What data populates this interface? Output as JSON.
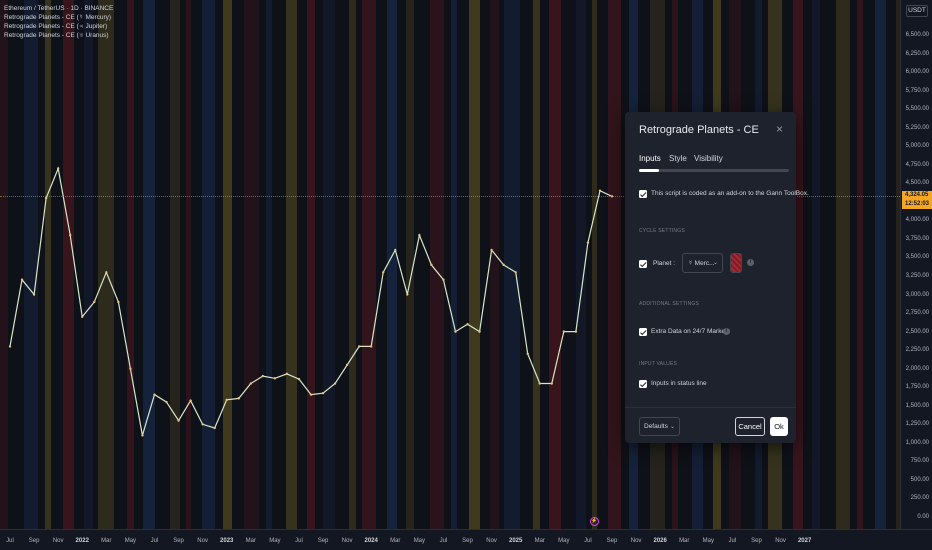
{
  "legend": {
    "symbol_line": "Ethereum / TetherUS · 1D · BINANCE",
    "indicators": [
      "Retrograde Planets - CE (☿ Mercury)",
      "Retrograde Planets - CE (♃ Jupiter)",
      "Retrograde Planets - CE (♅ Uranus)"
    ]
  },
  "quote_currency": "USDT",
  "y_axis_ticks": [
    "6,500.00",
    "6,250.00",
    "6,000.00",
    "5,750.00",
    "5,500.00",
    "5,250.00",
    "5,000.00",
    "4,750.00",
    "4,500.00",
    "4,250.00",
    "4,000.00",
    "3,750.00",
    "3,500.00",
    "3,250.00",
    "3,000.00",
    "2,750.00",
    "2,500.00",
    "2,250.00",
    "2,000.00",
    "1,750.00",
    "1,500.00",
    "1,250.00",
    "1,000.00",
    "750.00",
    "500.00",
    "250.00",
    "0.00"
  ],
  "price_tags": {
    "last_price": "4,324.05",
    "countdown": "12:52:03",
    "last_color": "#f5a623",
    "countdown_color": "#f5a623"
  },
  "x_axis_ticks": [
    {
      "label": "Jul",
      "year": false
    },
    {
      "label": "Sep",
      "year": false
    },
    {
      "label": "Nov",
      "year": false
    },
    {
      "label": "2022",
      "year": true
    },
    {
      "label": "Mar",
      "year": false
    },
    {
      "label": "May",
      "year": false
    },
    {
      "label": "Jul",
      "year": false
    },
    {
      "label": "Sep",
      "year": false
    },
    {
      "label": "Nov",
      "year": false
    },
    {
      "label": "2023",
      "year": true
    },
    {
      "label": "Mar",
      "year": false
    },
    {
      "label": "May",
      "year": false
    },
    {
      "label": "Jul",
      "year": false
    },
    {
      "label": "Sep",
      "year": false
    },
    {
      "label": "Nov",
      "year": false
    },
    {
      "label": "2024",
      "year": true
    },
    {
      "label": "Mar",
      "year": false
    },
    {
      "label": "May",
      "year": false
    },
    {
      "label": "Jul",
      "year": false
    },
    {
      "label": "Sep",
      "year": false
    },
    {
      "label": "Nov",
      "year": false
    },
    {
      "label": "2025",
      "year": true
    },
    {
      "label": "Mar",
      "year": false
    },
    {
      "label": "May",
      "year": false
    },
    {
      "label": "Jul",
      "year": false
    },
    {
      "label": "Sep",
      "year": false
    },
    {
      "label": "Nov",
      "year": false
    },
    {
      "label": "2026",
      "year": true
    },
    {
      "label": "Mar",
      "year": false
    },
    {
      "label": "May",
      "year": false
    },
    {
      "label": "Jul",
      "year": false
    },
    {
      "label": "Sep",
      "year": false
    },
    {
      "label": "Nov",
      "year": false
    },
    {
      "label": "2027",
      "year": true
    }
  ],
  "retrograde_band_colors": {
    "mercury": "#7a1d25",
    "jupiter": "#8a7a2a",
    "uranus": "#1f3d75"
  },
  "price_series": [
    {
      "date": "2021-07",
      "close": 2300
    },
    {
      "date": "2021-08",
      "close": 3200
    },
    {
      "date": "2021-09",
      "close": 3000
    },
    {
      "date": "2021-10",
      "close": 4300
    },
    {
      "date": "2021-11",
      "close": 4700
    },
    {
      "date": "2021-12",
      "close": 3800
    },
    {
      "date": "2022-01",
      "close": 2700
    },
    {
      "date": "2022-02",
      "close": 2900
    },
    {
      "date": "2022-03",
      "close": 3300
    },
    {
      "date": "2022-04",
      "close": 2900
    },
    {
      "date": "2022-05",
      "close": 2000
    },
    {
      "date": "2022-06",
      "close": 1100
    },
    {
      "date": "2022-07",
      "close": 1650
    },
    {
      "date": "2022-08",
      "close": 1550
    },
    {
      "date": "2022-09",
      "close": 1300
    },
    {
      "date": "2022-10",
      "close": 1570
    },
    {
      "date": "2022-11",
      "close": 1250
    },
    {
      "date": "2022-12",
      "close": 1200
    },
    {
      "date": "2023-01",
      "close": 1580
    },
    {
      "date": "2023-02",
      "close": 1600
    },
    {
      "date": "2023-03",
      "close": 1800
    },
    {
      "date": "2023-04",
      "close": 1900
    },
    {
      "date": "2023-05",
      "close": 1870
    },
    {
      "date": "2023-06",
      "close": 1930
    },
    {
      "date": "2023-07",
      "close": 1860
    },
    {
      "date": "2023-08",
      "close": 1650
    },
    {
      "date": "2023-09",
      "close": 1670
    },
    {
      "date": "2023-10",
      "close": 1800
    },
    {
      "date": "2023-11",
      "close": 2050
    },
    {
      "date": "2023-12",
      "close": 2300
    },
    {
      "date": "2024-01",
      "close": 2300
    },
    {
      "date": "2024-02",
      "close": 3300
    },
    {
      "date": "2024-03",
      "close": 3600
    },
    {
      "date": "2024-04",
      "close": 3000
    },
    {
      "date": "2024-05",
      "close": 3800
    },
    {
      "date": "2024-06",
      "close": 3400
    },
    {
      "date": "2024-07",
      "close": 3200
    },
    {
      "date": "2024-08",
      "close": 2500
    },
    {
      "date": "2024-09",
      "close": 2600
    },
    {
      "date": "2024-10",
      "close": 2500
    },
    {
      "date": "2024-11",
      "close": 3600
    },
    {
      "date": "2024-12",
      "close": 3400
    },
    {
      "date": "2025-01",
      "close": 3300
    },
    {
      "date": "2025-02",
      "close": 2200
    },
    {
      "date": "2025-03",
      "close": 1800
    },
    {
      "date": "2025-04",
      "close": 1800
    },
    {
      "date": "2025-05",
      "close": 2500
    },
    {
      "date": "2025-06",
      "close": 2500
    },
    {
      "date": "2025-07",
      "close": 3700
    },
    {
      "date": "2025-08",
      "close": 4400
    },
    {
      "date": "2025-09",
      "close": 4324
    }
  ],
  "dialog": {
    "title": "Retrograde Planets - CE",
    "tabs": [
      "Inputs",
      "Style",
      "Visibility"
    ],
    "addon_note": "This script is coded as an add-on to the Gann ToolBox.",
    "section_cycle": "CYCLE SETTINGS",
    "planet_label": "Planet :",
    "planet_value": "☿ Merc...",
    "section_additional": "ADDITIONAL SETTINGS",
    "extra_data_label": "Extra Data on 24/7 Markets",
    "section_input_values": "INPUT VALUES",
    "status_line_label": "Inputs in status line",
    "defaults_label": "Defaults",
    "cancel_label": "Cancel",
    "ok_label": "Ok",
    "close_icon": "×"
  }
}
